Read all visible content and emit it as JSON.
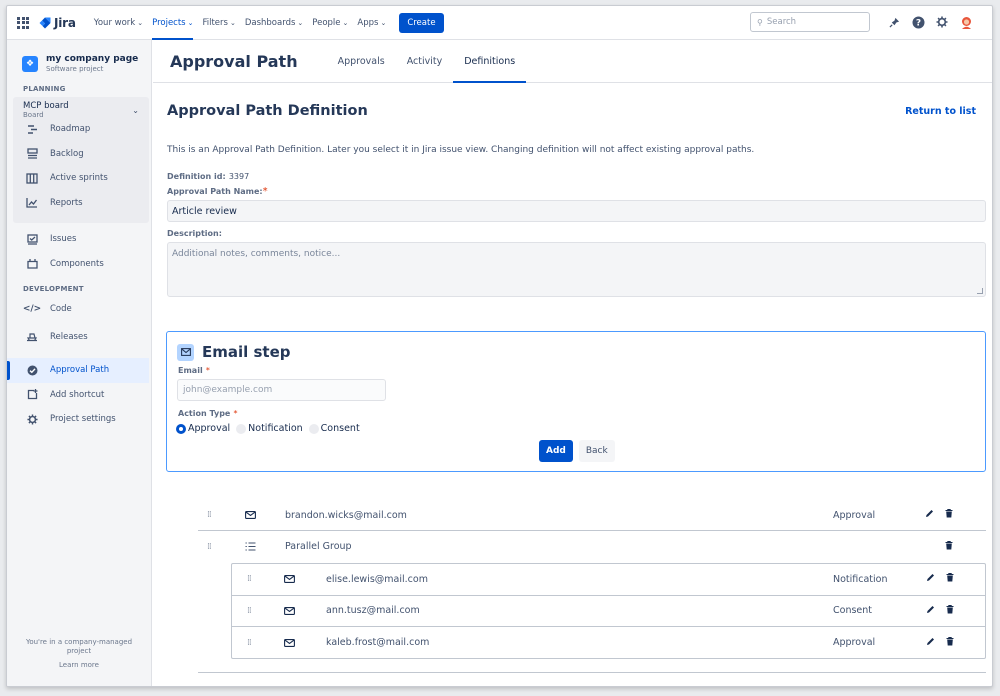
{
  "topnav": {
    "logo": "Jira",
    "items": [
      {
        "label": "Your work",
        "active": false
      },
      {
        "label": "Projects",
        "active": true
      },
      {
        "label": "Filters",
        "active": false
      },
      {
        "label": "Dashboards",
        "active": false
      },
      {
        "label": "People",
        "active": false
      },
      {
        "label": "Apps",
        "active": false
      }
    ],
    "create_label": "Create",
    "search_placeholder": "Search"
  },
  "sidebar": {
    "project_name": "my company page",
    "project_type": "Software project",
    "planning_label": "PLANNING",
    "board_title": "MCP board",
    "board_sub": "Board",
    "planning_items": [
      "Roadmap",
      "Backlog",
      "Active sprints",
      "Reports"
    ],
    "other_items": [
      "Issues",
      "Components"
    ],
    "development_label": "DEVELOPMENT",
    "development_items": [
      "Code",
      "Releases"
    ],
    "bottom_items": [
      "Approval Path",
      "Add shortcut",
      "Project settings"
    ],
    "footer_text": "You're in a company-managed project",
    "learn_more": "Learn more"
  },
  "header": {
    "title": "Approval Path",
    "tabs": [
      "Approvals",
      "Activity",
      "Definitions"
    ],
    "active_tab": "Definitions"
  },
  "definition": {
    "title": "Approval Path Definition",
    "return_link": "Return to list",
    "intro": "This is an Approval Path Definition. Later you select it in Jira issue view. Changing definition will not affect existing approval paths.",
    "id_label": "Definition id:",
    "id_value": "3397",
    "name_label": "Approval Path Name:",
    "name_value": "Article review",
    "description_label": "Description:",
    "description_placeholder": "Additional notes, comments, notice..."
  },
  "email_step": {
    "title": "Email step",
    "email_label": "Email",
    "email_placeholder": "john@example.com",
    "action_label": "Action Type",
    "options": [
      "Approval",
      "Notification",
      "Consent"
    ],
    "selected": "Approval",
    "add_label": "Add",
    "back_label": "Back"
  },
  "steps": {
    "first": {
      "email": "brandon.wicks@mail.com",
      "type": "Approval"
    },
    "group_label": "Parallel Group",
    "group_items": [
      {
        "email": "elise.lewis@mail.com",
        "type": "Notification"
      },
      {
        "email": "ann.tusz@mail.com",
        "type": "Consent"
      },
      {
        "email": "kaleb.frost@mail.com",
        "type": "Approval"
      }
    ]
  },
  "colors": {
    "accent": "#0052cc",
    "sidebar_bg": "#f4f5f7",
    "required": "#de350b"
  }
}
